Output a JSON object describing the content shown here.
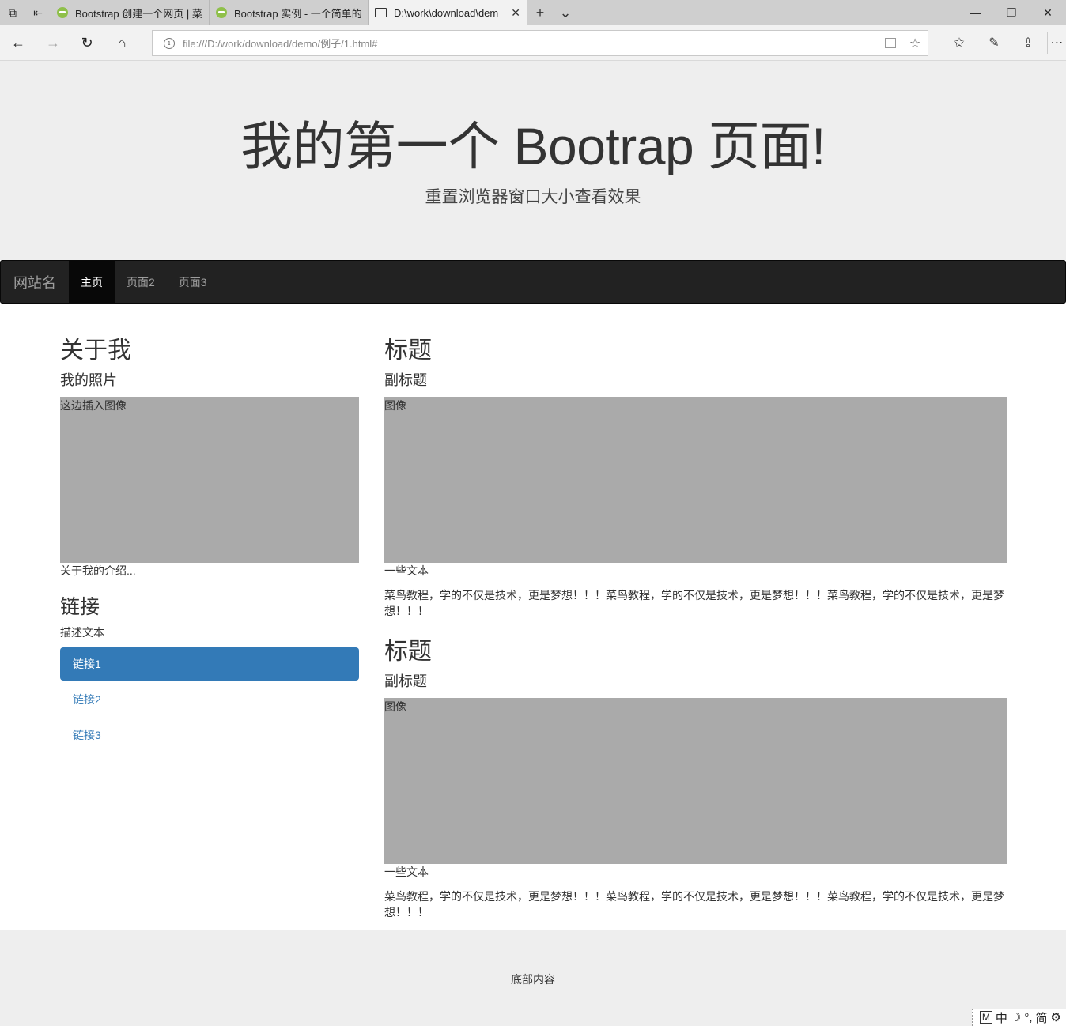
{
  "browser": {
    "tabs": [
      {
        "title": "Bootstrap 创建一个网页 | 菜"
      },
      {
        "title": "Bootstrap 实例 - 一个简单的"
      },
      {
        "title": "D:\\work\\download\\dem"
      }
    ],
    "new_tab": "+",
    "url": "file:///D:/work/download/demo/例子/1.html#"
  },
  "page": {
    "jumbotron": {
      "title": "我的第一个 Bootrap 页面!",
      "subtitle": "重置浏览器窗口大小查看效果"
    },
    "navbar": {
      "brand": "网站名",
      "links": [
        {
          "label": "主页",
          "active": true
        },
        {
          "label": "页面2",
          "active": false
        },
        {
          "label": "页面3",
          "active": false
        }
      ]
    },
    "sidebar": {
      "about_title": "关于我",
      "photo_title": "我的照片",
      "photo_placeholder": "这边插入图像",
      "intro": "关于我的介绍...",
      "links_title": "链接",
      "links_desc": "描述文本",
      "links": [
        {
          "label": "链接1",
          "active": true
        },
        {
          "label": "链接2",
          "active": false
        },
        {
          "label": "链接3",
          "active": false
        }
      ]
    },
    "articles": [
      {
        "title": "标题",
        "subtitle": "副标题",
        "image_label": "图像",
        "caption": "一些文本",
        "body": "菜鸟教程，学的不仅是技术，更是梦想！！！菜鸟教程，学的不仅是技术，更是梦想！！！菜鸟教程，学的不仅是技术，更是梦想！！！"
      },
      {
        "title": "标题",
        "subtitle": "副标题",
        "image_label": "图像",
        "caption": "一些文本",
        "body": "菜鸟教程，学的不仅是技术，更是梦想！！！菜鸟教程，学的不仅是技术，更是梦想！！！菜鸟教程，学的不仅是技术，更是梦想！！！"
      }
    ],
    "footer": "底部内容"
  },
  "ime": {
    "mode": "M",
    "lang": "中",
    "moon": "☽",
    "punct": "°,",
    "script": "简",
    "settings": "⚙"
  },
  "colors": {
    "navbar_bg": "#222222",
    "pill_active": "#337ab7",
    "link": "#337ab7",
    "placeholder": "#aaaaaa",
    "jumbotron_bg": "#eeeeee"
  }
}
